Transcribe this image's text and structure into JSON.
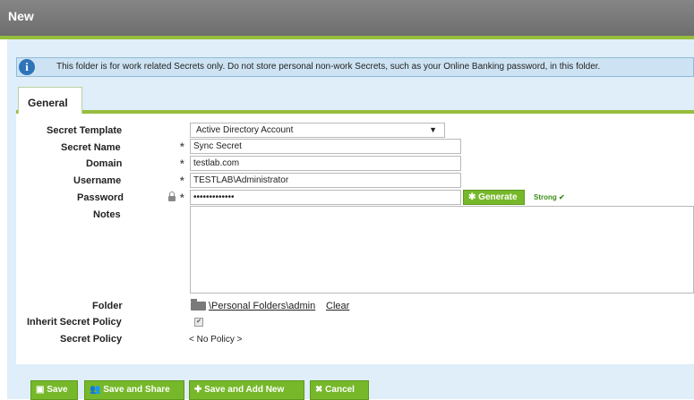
{
  "window": {
    "title": "New"
  },
  "info_bar": {
    "icon": "info-icon",
    "message": "This folder is for work related Secrets only. Do not store personal non-work Secrets, such as your Online Banking password, in this folder."
  },
  "tabs": [
    {
      "label": "General",
      "active": true
    }
  ],
  "form": {
    "secret_template": {
      "label": "Secret Template",
      "value": "Active Directory Account"
    },
    "secret_name": {
      "label": "Secret Name",
      "value": "Sync Secret",
      "required": true
    },
    "domain": {
      "label": "Domain",
      "value": "testlab.com",
      "required": true
    },
    "username": {
      "label": "Username",
      "value": "TESTLAB\\Administrator",
      "required": true
    },
    "password": {
      "label": "Password",
      "value": "•••••••••••••",
      "required": true,
      "generate_label": "Generate",
      "strength": "Strong"
    },
    "notes": {
      "label": "Notes",
      "value": ""
    },
    "folder": {
      "label": "Folder",
      "path": "\\Personal Folders\\admin",
      "clear_label": "Clear"
    },
    "inherit_policy": {
      "label": "Inherit Secret Policy",
      "checked": true
    },
    "secret_policy": {
      "label": "Secret Policy",
      "value": "< No Policy >"
    }
  },
  "required_mark": "*",
  "buttons": {
    "save": "Save",
    "save_share": "Save and Share",
    "save_add_new": "Save and Add New",
    "cancel": "Cancel"
  },
  "colors": {
    "accent_green": "#76b82a",
    "info_blue": "#2f73b8",
    "title_gray": "#7a7a7a"
  }
}
